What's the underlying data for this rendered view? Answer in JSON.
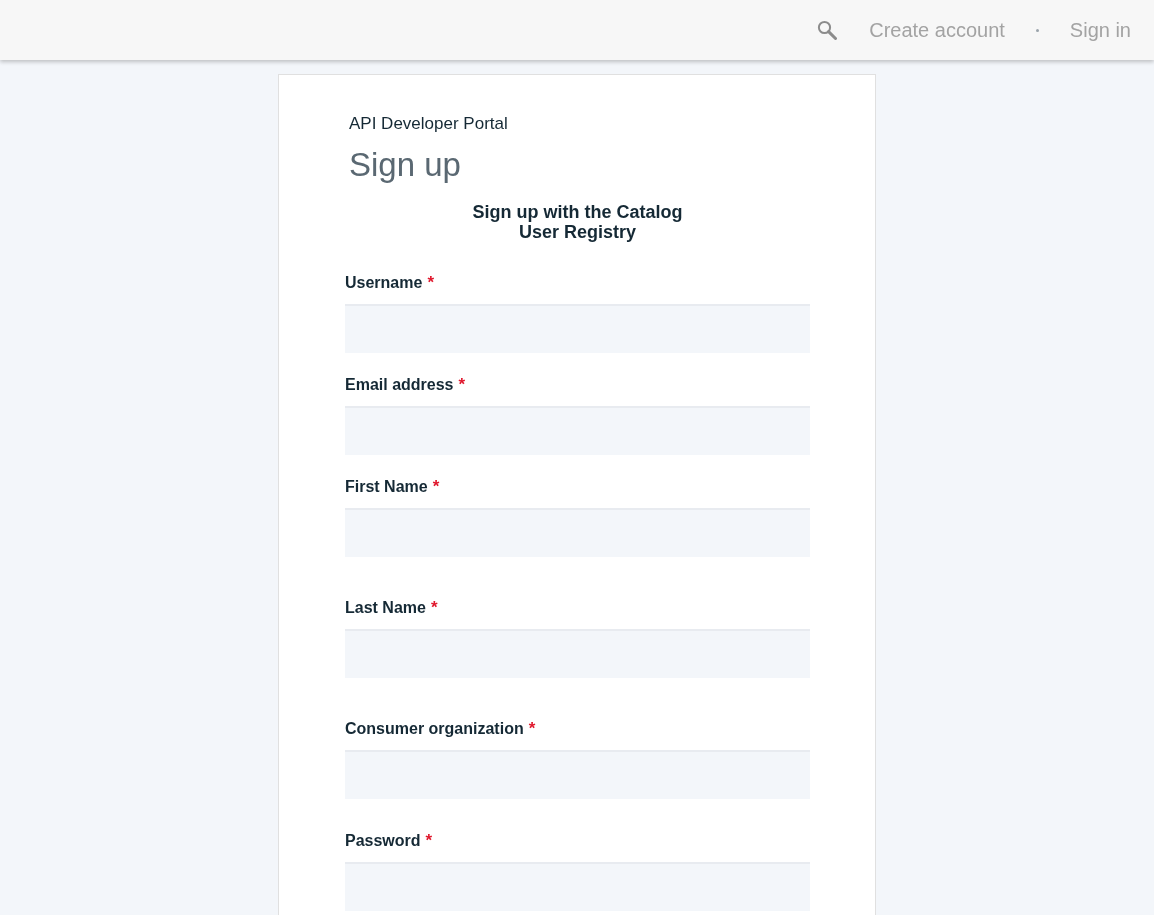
{
  "header": {
    "links": [
      {
        "label": "Create account"
      },
      {
        "label": "Sign in"
      }
    ]
  },
  "card": {
    "site_name": "API Developer Portal",
    "title": "Sign up",
    "subtitle": "Sign up with the Catalog User Registry"
  },
  "fields": [
    {
      "label": "Username",
      "required_mark": "*"
    },
    {
      "label": "Email address",
      "required_mark": "*"
    },
    {
      "label": "First Name",
      "required_mark": "*"
    },
    {
      "label": "Last Name",
      "required_mark": "*"
    },
    {
      "label": "Consumer organization",
      "required_mark": "*"
    },
    {
      "label": "Password",
      "required_mark": "*"
    }
  ]
}
